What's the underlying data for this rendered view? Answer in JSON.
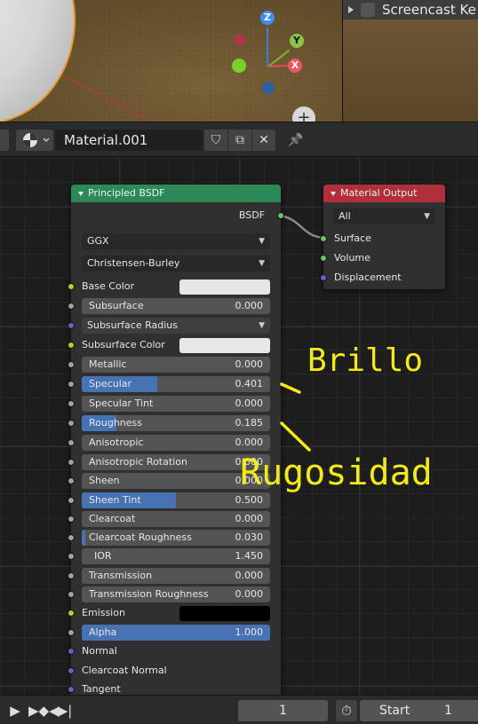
{
  "outliner": {
    "row_label": "Screencast Ke"
  },
  "gizmo": {
    "z_label": "Z",
    "y_label": "Y",
    "x_label": "X"
  },
  "zoom_glyph": "+",
  "header": {
    "material_name": "Material.001",
    "shield_glyph": "⛉",
    "copy_glyph": "⧉",
    "close_glyph": "✕",
    "pin_glyph": "📌"
  },
  "principled": {
    "title": "Principled BSDF",
    "output_label": "BSDF",
    "distribution": "GGX",
    "subsurface_method": "Christensen-Burley",
    "rows": {
      "base_color": "Base Color",
      "subsurface": {
        "label": "Subsurface",
        "value": "0.000",
        "fraction": 0.0
      },
      "subsurface_radius": "Subsurface Radius",
      "subsurface_color": "Subsurface Color",
      "metallic": {
        "label": "Metallic",
        "value": "0.000",
        "fraction": 0.0
      },
      "specular": {
        "label": "Specular",
        "value": "0.401",
        "fraction": 0.401
      },
      "specular_tint": {
        "label": "Specular Tint",
        "value": "0.000",
        "fraction": 0.0
      },
      "roughness": {
        "label": "Roughness",
        "value": "0.185",
        "fraction": 0.185
      },
      "anisotropic": {
        "label": "Anisotropic",
        "value": "0.000",
        "fraction": 0.0
      },
      "anisotropic_rotation": {
        "label": "Anisotropic Rotation",
        "value": "0.000",
        "fraction": 0.0
      },
      "sheen": {
        "label": "Sheen",
        "value": "0.000",
        "fraction": 0.0
      },
      "sheen_tint": {
        "label": "Sheen Tint",
        "value": "0.500",
        "fraction": 0.5
      },
      "clearcoat": {
        "label": "Clearcoat",
        "value": "0.000",
        "fraction": 0.0
      },
      "clearcoat_roughness": {
        "label": "Clearcoat Roughness",
        "value": "0.030",
        "fraction": 0.03
      },
      "ior": {
        "label": "IOR",
        "value": "1.450"
      },
      "transmission": {
        "label": "Transmission",
        "value": "0.000",
        "fraction": 0.0
      },
      "transmission_roughness": {
        "label": "Transmission Roughness",
        "value": "0.000",
        "fraction": 0.0
      },
      "emission": "Emission",
      "alpha": {
        "label": "Alpha",
        "value": "1.000",
        "fraction": 1.0
      },
      "normal": "Normal",
      "clearcoat_normal": "Clearcoat Normal",
      "tangent": "Tangent"
    },
    "colors": {
      "header": "#2b8a57",
      "base_color": "#e6e6e6",
      "subsurface_color": "#e8e8e8",
      "emission": "#000000"
    }
  },
  "material_output": {
    "title": "Material Output",
    "target": "All",
    "inputs": [
      "Surface",
      "Volume",
      "Displacement"
    ],
    "header_color": "#b02f3a"
  },
  "annotations": {
    "brillo": "Brillo",
    "rugosidad": "Rugosidad"
  },
  "timeline": {
    "current_frame": "1",
    "start_label": "Start",
    "start_value": "1"
  }
}
